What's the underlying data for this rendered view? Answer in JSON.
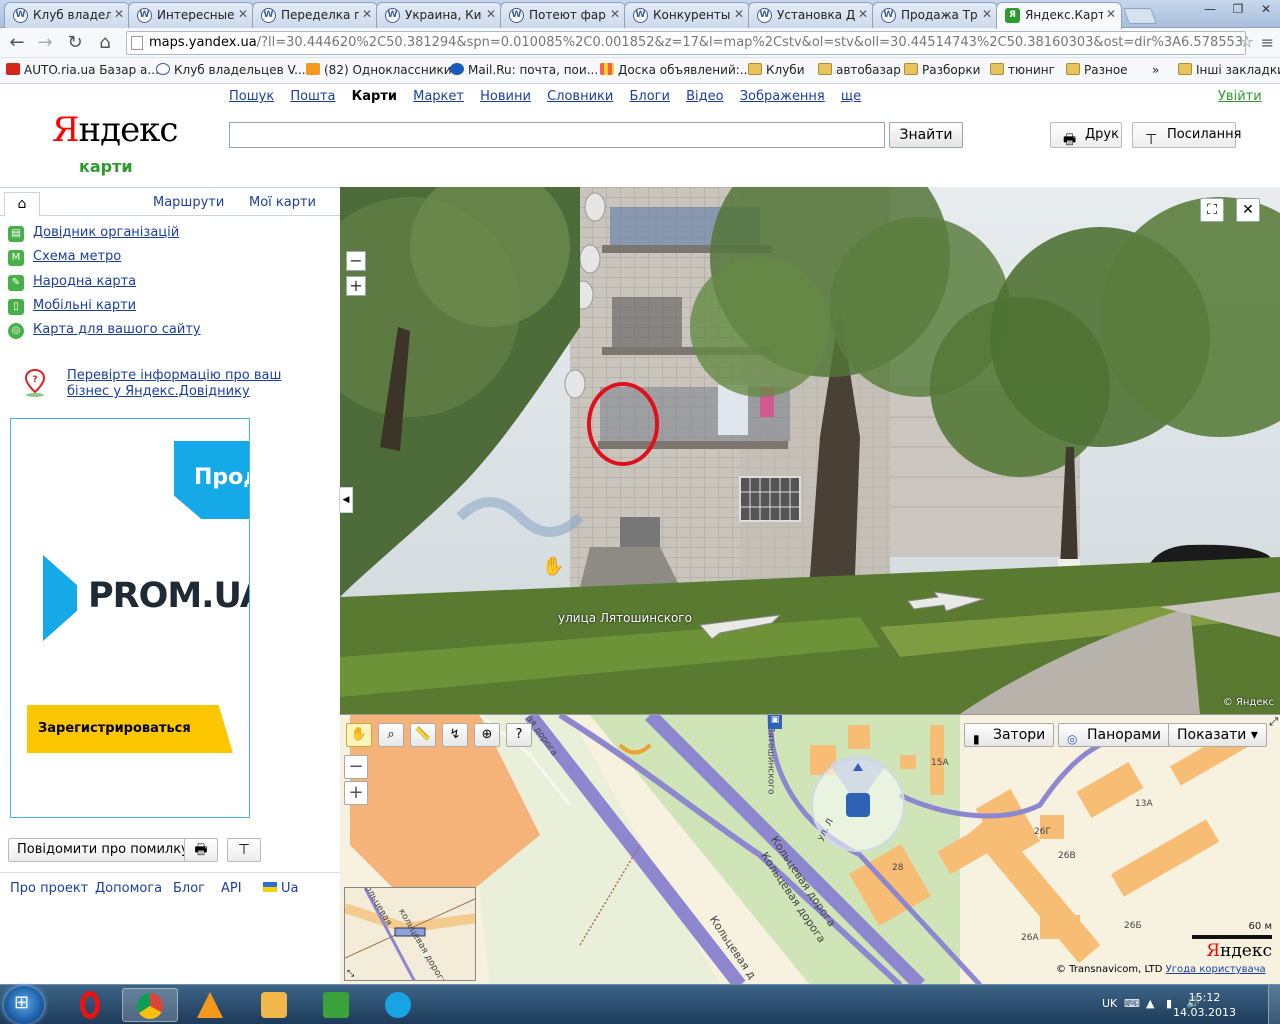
{
  "browser": {
    "tabs": [
      {
        "label": "Клуб владел",
        "icon": "vw-icon"
      },
      {
        "label": "Интересные",
        "icon": "vw-icon"
      },
      {
        "label": "Переделка г",
        "icon": "vw-icon"
      },
      {
        "label": "Украина, Ки",
        "icon": "vw-icon"
      },
      {
        "label": "Потеют фар",
        "icon": "vw-icon"
      },
      {
        "label": "Конкуренты",
        "icon": "vw-icon"
      },
      {
        "label": "Установка Д",
        "icon": "vw-icon"
      },
      {
        "label": "Продажа Тр",
        "icon": "vw-icon"
      },
      {
        "label": "Яндекс.Карт",
        "icon": "yandex-maps-icon"
      }
    ],
    "url_host": "maps.yandex.ua",
    "url_rest": "/?ll=30.444620%2C50.381294&spn=0.010085%2C0.001852&z=17&l=map%2Cstv&ol=stv&oll=30.44514743%2C50.38160303&ost=dir%3A6.578553",
    "bookmarks": [
      {
        "label": "AUTO.ria.ua Базар a...",
        "icon": "car-icon"
      },
      {
        "label": "Клуб владельцев V...",
        "icon": "vw-icon"
      },
      {
        "label": "(82) Одноклассники",
        "icon": "ok-icon"
      },
      {
        "label": "Mail.Ru: почта, пои...",
        "icon": "mailru-icon"
      },
      {
        "label": "Доска объявлений:...",
        "icon": "board-icon"
      },
      {
        "label": "Клуби",
        "icon": "folder-icon"
      },
      {
        "label": "автобазар",
        "icon": "folder-icon"
      },
      {
        "label": "Разборки",
        "icon": "folder-icon"
      },
      {
        "label": "тюнинг",
        "icon": "folder-icon"
      },
      {
        "label": "Разное",
        "icon": "folder-icon"
      },
      {
        "label": "»",
        "icon": ""
      },
      {
        "label": "Інші закладки",
        "icon": "folder-icon"
      }
    ]
  },
  "yandex": {
    "logo_first": "Я",
    "logo_rest": "ндекс",
    "service": "карти",
    "nav": [
      "Пошук",
      "Пошта",
      "Карти",
      "Маркет",
      "Новини",
      "Словники",
      "Блоги",
      "Відео",
      "Зображення",
      "ще"
    ],
    "nav_current": "Карти",
    "login": "Увійти",
    "search_value": "",
    "find_button": "Знайти",
    "print_button": "Друк",
    "link_button": "Посилання"
  },
  "left_panel": {
    "tabs": [
      "Маршрути",
      "Мої карти"
    ],
    "links": [
      {
        "label": "Довідник організацій",
        "icon": "directory-icon"
      },
      {
        "label": "Схема метро",
        "icon": "metro-icon"
      },
      {
        "label": "Народна карта",
        "icon": "people-map-icon"
      },
      {
        "label": "Мобільні карти",
        "icon": "mobile-icon"
      },
      {
        "label": "Карта для вашого сайту",
        "icon": "site-map-icon"
      }
    ],
    "business_link": "Перевірте інформацію про ваш бізнес у Яндекс.Довіднику",
    "ad": {
      "top_text": "Прод",
      "brand": "PROM.UA",
      "cta": "Зарегистрироваться",
      "accent": "#16a9e8",
      "cta_color": "#fcc700"
    },
    "report_error": "Повідомити про помилку",
    "footer": [
      "Про проект",
      "Допомога",
      "Блог",
      "API",
      "Ua"
    ]
  },
  "panorama": {
    "street_label": "улица Лятошинского",
    "copyright": "© Яндекс"
  },
  "map": {
    "buttons": [
      "Затори",
      "Панорами",
      "Показати ▾"
    ],
    "labels": {
      "road1": "Кольцевая дорога",
      "road2": "Кольцевая дорога",
      "road3": "Кольцевая д",
      "street_v": "Лятошинского",
      "road_top": "ая дорога",
      "street_diag": "ул. Л",
      "minimap_road1": "Кольцевая",
      "minimap_road2": "кольцевая дорога",
      "h15a": "15А",
      "h13a": "13А",
      "h26g": "26Г",
      "h26v": "26В",
      "h28": "28",
      "h26a": "26А",
      "h26b": "26Б"
    },
    "scale": "60 м",
    "logo_first": "Я",
    "logo_rest": "ндекс",
    "copyright": "© Transnavicom, LTD",
    "terms": "Угода користувача"
  },
  "taskbar": {
    "apps": [
      "opera-icon",
      "chrome-icon",
      "aimp-icon",
      "media-player-icon",
      "utorrent-icon",
      "skype-icon"
    ],
    "lang": "UK",
    "time": "15:12",
    "date": "14.03.2013"
  }
}
